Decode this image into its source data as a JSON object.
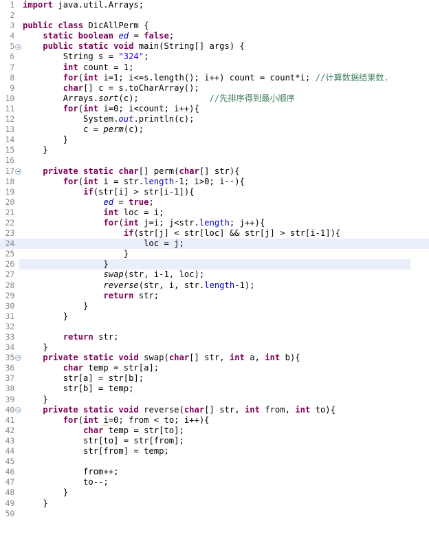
{
  "editor": {
    "language": "java",
    "class_name": "DicAllPerm",
    "current_line": 24,
    "first_line": 1,
    "last_line": 50,
    "colors": {
      "background": "#ffffff",
      "line_number": "#888888",
      "keyword": "#7f0055",
      "string": "#2a00ff",
      "comment": "#3f7f5f",
      "field": "#0000c0",
      "current_line_highlight": "#e9effa",
      "fold_marker_border": "#9fb3cd"
    },
    "fold_markers": [
      5,
      17,
      35,
      40
    ],
    "lines": [
      {
        "n": 1,
        "text": "import java.util.Arrays;"
      },
      {
        "n": 2,
        "text": ""
      },
      {
        "n": 3,
        "text": "public class DicAllPerm {"
      },
      {
        "n": 4,
        "text": "    static boolean ed = false;"
      },
      {
        "n": 5,
        "text": "    public static void main(String[] args) {"
      },
      {
        "n": 6,
        "text": "        String s = \"324\";"
      },
      {
        "n": 7,
        "text": "        int count = 1;"
      },
      {
        "n": 8,
        "text": "        for(int i=1; i<=s.length(); i++) count = count*i; //计算数据结果数."
      },
      {
        "n": 9,
        "text": "        char[] c = s.toCharArray();"
      },
      {
        "n": 10,
        "text": "        Arrays.sort(c);              //先排序得到最小顺序"
      },
      {
        "n": 11,
        "text": "        for(int i=0; i<count; i++){"
      },
      {
        "n": 12,
        "text": "            System.out.println(c);"
      },
      {
        "n": 13,
        "text": "            c = perm(c);"
      },
      {
        "n": 14,
        "text": "        }"
      },
      {
        "n": 15,
        "text": "    }"
      },
      {
        "n": 16,
        "text": ""
      },
      {
        "n": 17,
        "text": "    private static char[] perm(char[] str){"
      },
      {
        "n": 18,
        "text": "        for(int i = str.length-1; i>0; i--){"
      },
      {
        "n": 19,
        "text": "            if(str[i] > str[i-1]){"
      },
      {
        "n": 20,
        "text": "                ed = true;"
      },
      {
        "n": 21,
        "text": "                int loc = i;"
      },
      {
        "n": 22,
        "text": "                for(int j=i; j<str.length; j++){"
      },
      {
        "n": 23,
        "text": "                    if(str[j] < str[loc] && str[j] > str[i-1]){"
      },
      {
        "n": 24,
        "text": "                        loc = j;"
      },
      {
        "n": 25,
        "text": "                    }"
      },
      {
        "n": 26,
        "text": "                }"
      },
      {
        "n": 27,
        "text": "                swap(str, i-1, loc);"
      },
      {
        "n": 28,
        "text": "                reverse(str, i, str.length-1);"
      },
      {
        "n": 29,
        "text": "                return str;"
      },
      {
        "n": 30,
        "text": "            }"
      },
      {
        "n": 31,
        "text": "        }"
      },
      {
        "n": 32,
        "text": ""
      },
      {
        "n": 33,
        "text": "        return str;"
      },
      {
        "n": 34,
        "text": "    }"
      },
      {
        "n": 35,
        "text": "    private static void swap(char[] str, int a, int b){"
      },
      {
        "n": 36,
        "text": "        char temp = str[a];"
      },
      {
        "n": 37,
        "text": "        str[a] = str[b];"
      },
      {
        "n": 38,
        "text": "        str[b] = temp;"
      },
      {
        "n": 39,
        "text": "    }"
      },
      {
        "n": 40,
        "text": "    private static void reverse(char[] str, int from, int to){"
      },
      {
        "n": 41,
        "text": "        for(int i=0; from < to; i++){"
      },
      {
        "n": 42,
        "text": "            char temp = str[to];"
      },
      {
        "n": 43,
        "text": "            str[to] = str[from];"
      },
      {
        "n": 44,
        "text": "            str[from] = temp;"
      },
      {
        "n": 45,
        "text": ""
      },
      {
        "n": 46,
        "text": "            from++;"
      },
      {
        "n": 47,
        "text": "            to--;"
      },
      {
        "n": 48,
        "text": "        }"
      },
      {
        "n": 49,
        "text": "    }"
      },
      {
        "n": 50,
        "text": ""
      }
    ],
    "comments": {
      "line8": "//计算数据结果数.",
      "line10": "//先排序得到最小顺序"
    }
  }
}
